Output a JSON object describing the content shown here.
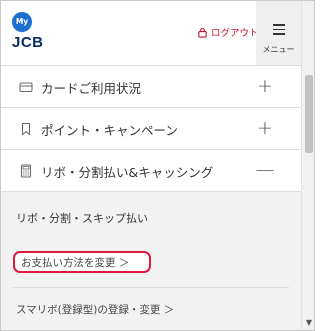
{
  "header": {
    "logo_badge": "My",
    "logo_text": "JCB",
    "logout_label": "ログアウト",
    "menu_label": "メニュー"
  },
  "accordion": [
    {
      "icon": "card-icon",
      "label": "カードご利用状況",
      "toggle": "+"
    },
    {
      "icon": "bookmark-icon",
      "label": "ポイント・キャンペーン",
      "toggle": "+"
    },
    {
      "icon": "calculator-icon",
      "label": "リボ・分割払い&キャッシング",
      "toggle": "—"
    }
  ],
  "submenu": {
    "heading": "リボ・分割・スキップ払い",
    "links": [
      {
        "label": "お支払い方法を変更 ＞",
        "highlighted": true
      },
      {
        "label": "スマリボ(登録型)の登録・変更 ＞",
        "highlighted": false
      }
    ]
  },
  "colors": {
    "brand_blue": "#1a6fd1",
    "logout_red": "#c8102e",
    "highlight_red": "#e0173f"
  }
}
